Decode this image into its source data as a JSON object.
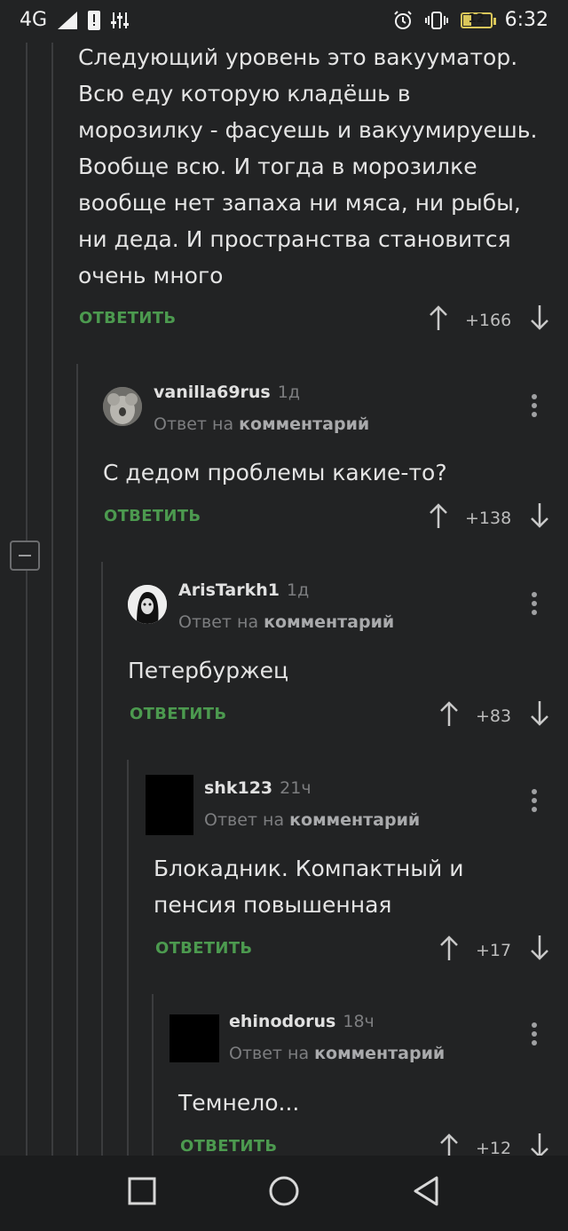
{
  "status_bar": {
    "network": "4G",
    "time": "6:32",
    "battery_level": "12"
  },
  "comments": [
    {
      "text_lines": [
        "Следующий уровень это вакууматор.",
        "Всю еду которую кладёшь в",
        "морозилку - фасуешь и вакуумируешь.",
        "Вообще всю. И тогда в морозилке",
        "вообще нет запаха ни мяса, ни рыбы,",
        "ни деда. И пространства становится",
        "очень много"
      ],
      "reply_label": "ОТВЕТИТЬ",
      "score": "+166"
    },
    {
      "username": "vanilla69rus",
      "time": "1д",
      "answer_prefix": "Ответ на",
      "answer_target": "комментарий",
      "text_lines": [
        "С дедом проблемы какие-то?"
      ],
      "reply_label": "ОТВЕТИТЬ",
      "score": "+138"
    },
    {
      "username": "ArisTarkh1",
      "time": "1д",
      "answer_prefix": "Ответ на",
      "answer_target": "комментарий",
      "text_lines": [
        "Петербуржец"
      ],
      "reply_label": "ОТВЕТИТЬ",
      "score": "+83"
    },
    {
      "username": "shk123",
      "time": "21ч",
      "answer_prefix": "Ответ на",
      "answer_target": "комментарий",
      "text_lines": [
        "Блокадник. Компактный и",
        "пенсия повышенная"
      ],
      "reply_label": "ОТВЕТИТЬ",
      "score": "+17"
    },
    {
      "username": "ehinodorus",
      "time": "18ч",
      "answer_prefix": "Ответ на",
      "answer_target": "комментарий",
      "text_lines": [
        "Темнело..."
      ],
      "reply_label": "ОТВЕТИТЬ",
      "score": "+12"
    }
  ],
  "colors": {
    "background": "#222324",
    "reply_green": "#4c9a4f",
    "muted": "#7d7e80"
  }
}
